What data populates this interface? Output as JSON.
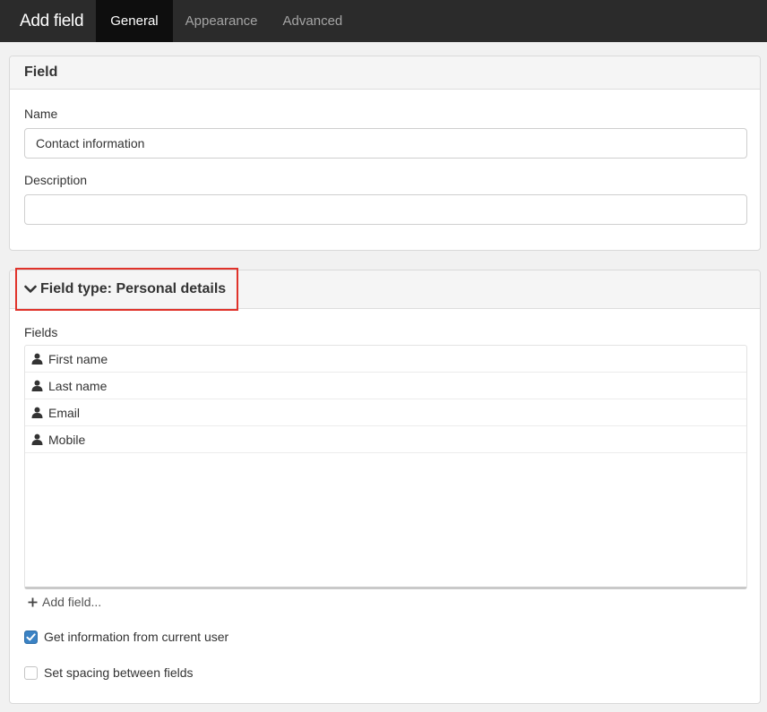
{
  "header": {
    "title": "Add field",
    "tabs": [
      {
        "label": "General",
        "active": true
      },
      {
        "label": "Appearance",
        "active": false
      },
      {
        "label": "Advanced",
        "active": false
      }
    ]
  },
  "field_panel": {
    "heading": "Field",
    "name_label": "Name",
    "name_value": "Contact information",
    "description_label": "Description",
    "description_value": ""
  },
  "field_type_panel": {
    "heading": "Field type: Personal details",
    "fields_label": "Fields",
    "fields": [
      {
        "label": "First name",
        "icon": "user-icon"
      },
      {
        "label": "Last name",
        "icon": "user-icon"
      },
      {
        "label": "Email",
        "icon": "user-icon"
      },
      {
        "label": "Mobile",
        "icon": "user-icon"
      }
    ],
    "add_field_label": "Add field...",
    "options": [
      {
        "label": "Get information from current user",
        "checked": true
      },
      {
        "label": "Set spacing between fields",
        "checked": false
      }
    ]
  },
  "colors": {
    "topbar": "#2b2b2b",
    "active_tab": "#0e0e0e",
    "checkbox_checked": "#3a82c4",
    "highlight": "#e0322a"
  }
}
